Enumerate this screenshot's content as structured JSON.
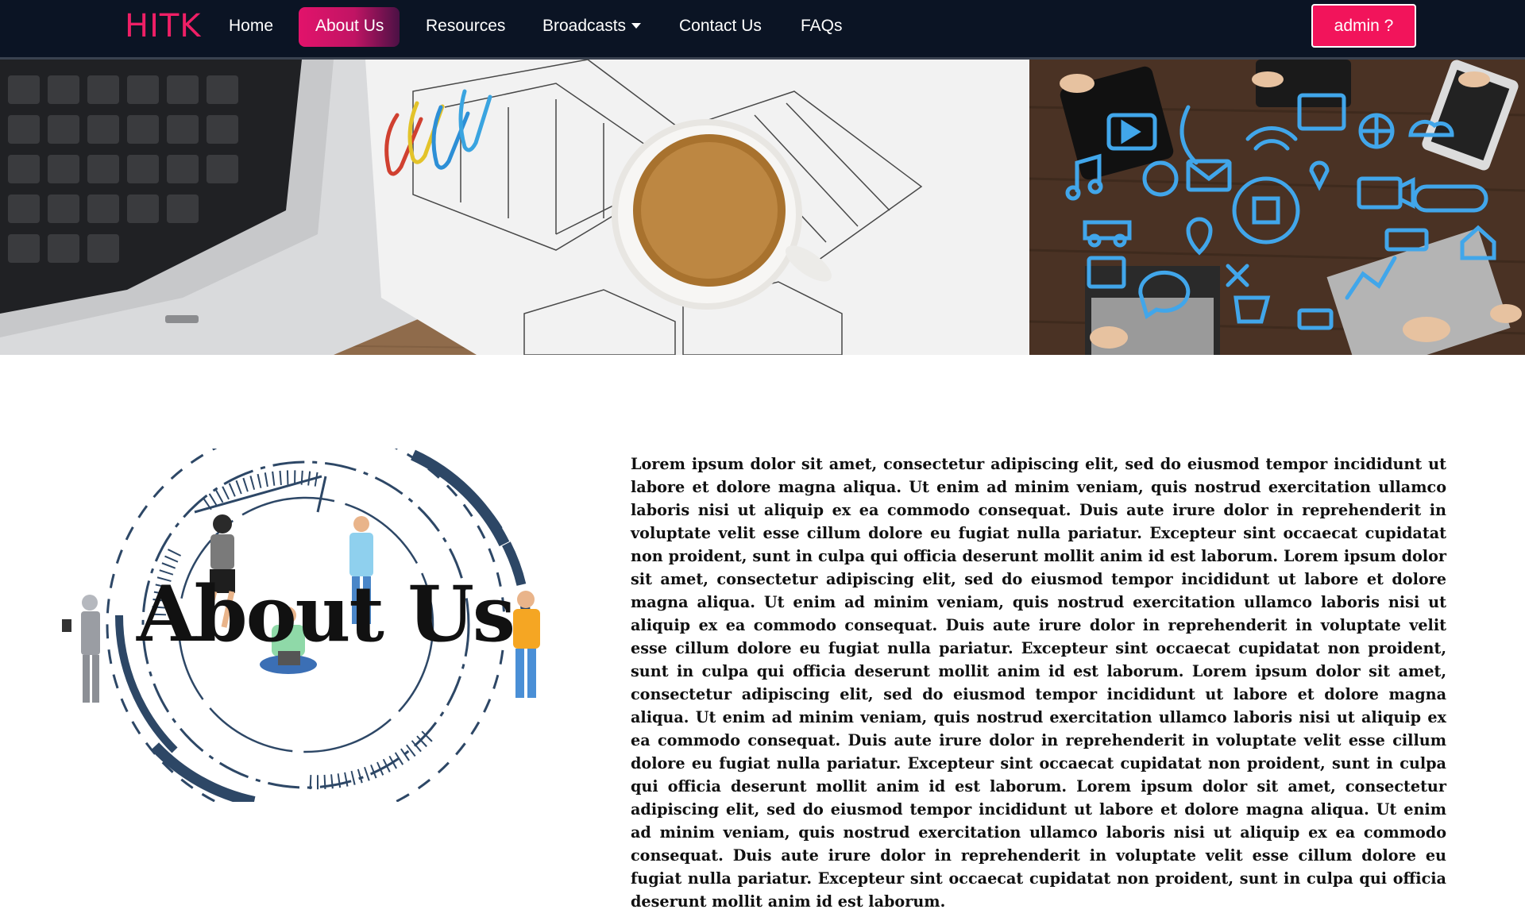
{
  "navbar": {
    "brand": "HITK",
    "links": [
      "Home",
      "About Us",
      "Resources",
      "Broadcasts",
      "Contact Us",
      "FAQs"
    ],
    "active": "About Us",
    "admin_label": "admin ?"
  },
  "hero": {
    "left_image": "desk with laptop keyboard, coffee cup, paper clips and house sketches",
    "right_image": "people using devices on wooden table with blue technology icons"
  },
  "about": {
    "graphic_title": "About Us",
    "paragraph": "Lorem ipsum dolor sit amet, consectetur adipiscing elit, sed do eiusmod tempor incididunt ut labore et dolore magna aliqua. Ut enim ad minim veniam, quis nostrud exercitation ullamco laboris nisi ut aliquip ex ea commodo consequat. Duis aute irure dolor in reprehenderit in voluptate velit esse cillum dolore eu fugiat nulla pariatur. Excepteur sint occaecat cupidatat non proident, sunt in culpa qui officia deserunt mollit anim id est laborum. Lorem ipsum dolor sit amet, consectetur adipiscing elit, sed do eiusmod tempor incididunt ut labore et dolore magna aliqua. Ut enim ad minim veniam, quis nostrud exercitation ullamco laboris nisi ut aliquip ex ea commodo consequat. Duis aute irure dolor in reprehenderit in voluptate velit esse cillum dolore eu fugiat nulla pariatur. Excepteur sint occaecat cupidatat non proident, sunt in culpa qui officia deserunt mollit anim id est laborum. Lorem ipsum dolor sit amet, consectetur adipiscing elit, sed do eiusmod tempor incididunt ut labore et dolore magna aliqua. Ut enim ad minim veniam, quis nostrud exercitation ullamco laboris nisi ut aliquip ex ea commodo consequat. Duis aute irure dolor in reprehenderit in voluptate velit esse cillum dolore eu fugiat nulla pariatur. Excepteur sint occaecat cupidatat non proident, sunt in culpa qui officia deserunt mollit anim id est laborum. Lorem ipsum dolor sit amet, consectetur adipiscing elit, sed do eiusmod tempor incididunt ut labore et dolore magna aliqua. Ut enim ad minim veniam, quis nostrud exercitation ullamco laboris nisi ut aliquip ex ea commodo consequat. Duis aute irure dolor in reprehenderit in voluptate velit esse cillum dolore eu fugiat nulla pariatur. Excepteur sint occaecat cupidatat non proident, sunt in culpa qui officia deserunt mollit anim id est laborum."
  },
  "colors": {
    "nav_bg": "#0b1424",
    "brand": "#ef1f66",
    "admin_bg": "#f2145b",
    "active_gradient_start": "#e2136b",
    "active_gradient_end": "#4b1145",
    "ring_navy": "#2d4766",
    "tech_icon_blue": "#3fa2e6"
  }
}
